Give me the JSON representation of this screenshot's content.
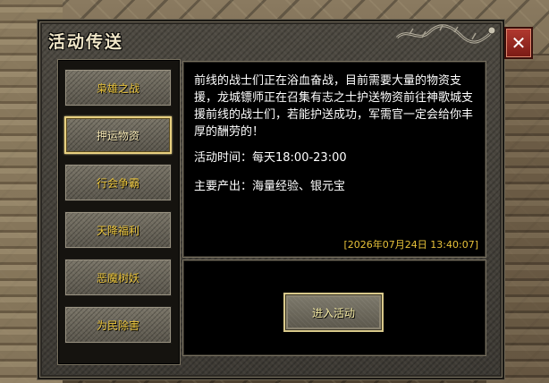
{
  "window": {
    "title": "活动传送",
    "close_label": "✕"
  },
  "menu": {
    "items": [
      {
        "label": "枭雄之战",
        "active": false
      },
      {
        "label": "押运物资",
        "active": true
      },
      {
        "label": "行会争霸",
        "active": false
      },
      {
        "label": "天降福利",
        "active": false
      },
      {
        "label": "恶魔树妖",
        "active": false
      },
      {
        "label": "为民除害",
        "active": false
      }
    ]
  },
  "description": {
    "body": "前线的战士们正在浴血奋战，目前需要大量的物资支援，龙城镖师正在召集有志之士护送物资前往神歌城支援前线的战士们，若能护送成功，军需官一定会给你丰厚的酬劳的！",
    "time_line": "活动时间：每天18:00-23:00",
    "reward_line": "主要产出：海量经验、银元宝",
    "timestamp": "[2026年07月24日 13:40:07]"
  },
  "actions": {
    "enter_label": "进入活动"
  },
  "colors": {
    "menu_text": "#e8c23a",
    "timestamp": "#e8c23a",
    "close_bg": "#9a2a22"
  }
}
